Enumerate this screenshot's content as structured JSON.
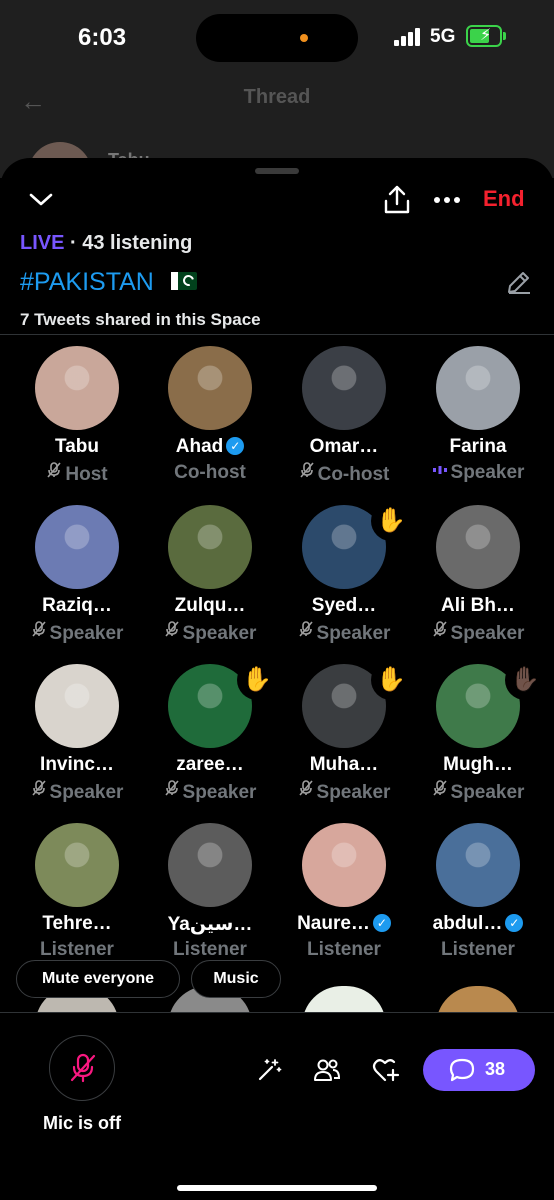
{
  "status_bar": {
    "time": "6:03",
    "network": "5G"
  },
  "thread": {
    "back_icon": "back-arrow-icon",
    "title": "Thread",
    "preview_name": "Tabu"
  },
  "space": {
    "end_label": "End",
    "live_label": "LIVE",
    "separator": "·",
    "listening_text": "43 listening",
    "title": "#PAKISTAN",
    "tweets_shared": "7 Tweets shared in this Space"
  },
  "participants": [
    {
      "name": "Tabu",
      "role": "Host",
      "role_state": "muted",
      "verified": false,
      "hand_raised": false,
      "avatar_color": "#c9a79a"
    },
    {
      "name": "Ahad",
      "role": "Co-host",
      "role_state": "none",
      "verified": true,
      "hand_raised": false,
      "avatar_color": "#8a6d4a"
    },
    {
      "name": "Omar…",
      "role": "Co-host",
      "role_state": "muted",
      "verified": false,
      "hand_raised": false,
      "avatar_color": "#3b3f46"
    },
    {
      "name": "Farina",
      "role": "Speaker",
      "role_state": "speaking",
      "verified": false,
      "hand_raised": false,
      "avatar_color": "#9aa0a8"
    },
    {
      "name": "Raziq…",
      "role": "Speaker",
      "role_state": "muted",
      "verified": false,
      "hand_raised": false,
      "avatar_color": "#6c7bb3"
    },
    {
      "name": "Zulqu…",
      "role": "Speaker",
      "role_state": "muted",
      "verified": false,
      "hand_raised": false,
      "avatar_color": "#5a6b3e"
    },
    {
      "name": "Syed…",
      "role": "Speaker",
      "role_state": "muted",
      "verified": false,
      "hand_raised": true,
      "hand": "✋",
      "avatar_color": "#2c4a6b"
    },
    {
      "name": "Ali Bh…",
      "role": "Speaker",
      "role_state": "muted",
      "verified": false,
      "hand_raised": false,
      "avatar_color": "#6a6a6a"
    },
    {
      "name": "Invinc…",
      "role": "Speaker",
      "role_state": "muted",
      "verified": false,
      "hand_raised": false,
      "avatar_color": "#d9d4cd"
    },
    {
      "name": "zaree…",
      "role": "Speaker",
      "role_state": "muted",
      "verified": false,
      "hand_raised": true,
      "hand": "✋",
      "avatar_color": "#1f6b3a"
    },
    {
      "name": "Muha…",
      "role": "Speaker",
      "role_state": "muted",
      "verified": false,
      "hand_raised": true,
      "hand": "✋",
      "avatar_color": "#3a3d40"
    },
    {
      "name": "Mugh…",
      "role": "Speaker",
      "role_state": "muted",
      "verified": false,
      "hand_raised": true,
      "hand": "✋🏿",
      "avatar_color": "#3f7a4a"
    },
    {
      "name": "Tehre…",
      "role": "Listener",
      "role_state": "none",
      "verified": false,
      "hand_raised": false,
      "avatar_color": "#7d8a5a"
    },
    {
      "name": "Yaسین…",
      "role": "Listener",
      "role_state": "none",
      "verified": false,
      "hand_raised": false,
      "avatar_color": "#5c5c5c"
    },
    {
      "name": "Naure…",
      "role": "Listener",
      "role_state": "none",
      "verified": true,
      "hand_raised": false,
      "avatar_color": "#d7a79c"
    },
    {
      "name": "abdul…",
      "role": "Listener",
      "role_state": "none",
      "verified": true,
      "hand_raised": false,
      "avatar_color": "#4a6f9a"
    }
  ],
  "chips": {
    "mute_everyone": "Mute everyone",
    "music": "Music"
  },
  "bottom_bar": {
    "mic_label": "Mic is off",
    "comment_count": "38"
  },
  "colors": {
    "accent": "#7856ff",
    "end": "#f4212e",
    "link": "#1d9bf0",
    "muted": "#f91880"
  }
}
